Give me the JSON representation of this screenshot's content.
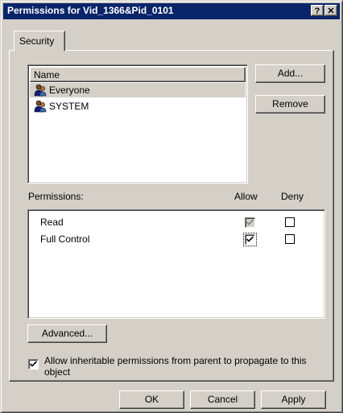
{
  "window": {
    "title": "Permissions for Vid_1366&Pid_0101",
    "help_glyph": "?",
    "close_glyph": "✕"
  },
  "tabs": [
    {
      "label": "Security"
    }
  ],
  "names": {
    "header": "Name",
    "items": [
      {
        "label": "Everyone",
        "icon": "group-users-icon",
        "selected": true
      },
      {
        "label": "SYSTEM",
        "icon": "group-users-icon",
        "selected": false
      }
    ]
  },
  "buttons": {
    "add_label": "Add...",
    "remove_label": "Remove",
    "advanced_label": "Advanced...",
    "ok_label": "OK",
    "cancel_label": "Cancel",
    "apply_label": "Apply"
  },
  "permissions": {
    "label": "Permissions:",
    "allow_header": "Allow",
    "deny_header": "Deny",
    "rows": [
      {
        "label": "Read",
        "allow": "checked-disabled",
        "deny": "unchecked"
      },
      {
        "label": "Full Control",
        "allow": "checked",
        "deny": "unchecked"
      }
    ]
  },
  "inherit": {
    "checked": true,
    "label_line1": "Allow inheritable permissions from parent to propagate to this",
    "label_line2": "object"
  }
}
